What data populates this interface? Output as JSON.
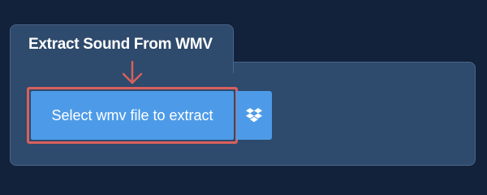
{
  "panel": {
    "title": "Extract Sound From WMV"
  },
  "upload": {
    "select_label": "Select wmv file to extract",
    "dropbox_icon": "dropbox-icon"
  },
  "annotation": {
    "arrow_icon": "arrow-down-icon",
    "highlight_color": "#d9605c"
  },
  "colors": {
    "page_background": "#12223a",
    "panel_background": "#2e4a6c",
    "button_background": "#4d9be8"
  }
}
